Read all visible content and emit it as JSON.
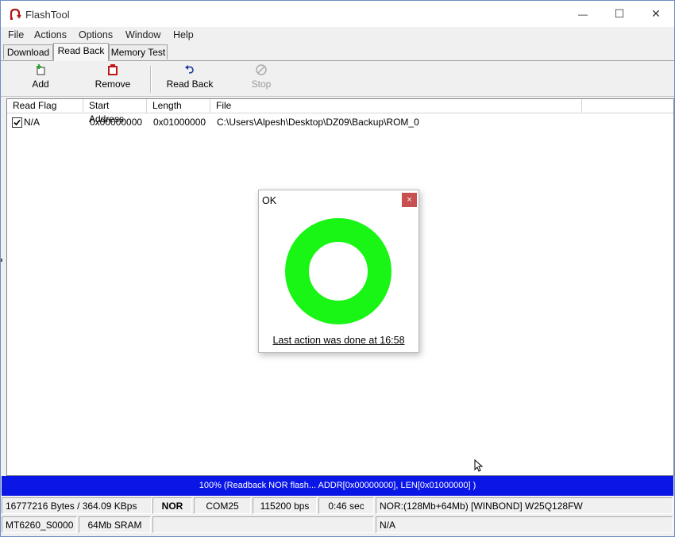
{
  "window": {
    "title": "FlashTool",
    "minimize_symbol": "—",
    "maximize_symbol": "☐",
    "close_symbol": "✕"
  },
  "menu": [
    "File",
    "Actions",
    "Options",
    "Window",
    "Help"
  ],
  "tabs": [
    {
      "label": "Download",
      "active": false
    },
    {
      "label": "Read Back",
      "active": true
    },
    {
      "label": "Memory Test",
      "active": false
    }
  ],
  "toolbar": {
    "add_label": "Add",
    "remove_label": "Remove",
    "readback_label": "Read Back",
    "stop_label": "Stop"
  },
  "list": {
    "columns": [
      "Read Flag",
      "Start Address",
      "Length",
      "File"
    ],
    "rows": [
      {
        "checked": true,
        "read_flag": "N/A",
        "start_address": "0x00000000",
        "length": "0x01000000",
        "file": "C:\\Users\\Alpesh\\Desktop\\DZ09\\Backup\\ROM_0"
      }
    ]
  },
  "dialog": {
    "title": "OK",
    "close_symbol": "×",
    "message": "Last action was done at 16:58",
    "ring_color": "#19f514"
  },
  "progress": {
    "text": "100% (Readback NOR flash... ADDR[0x00000000], LEN[0x01000000]  )",
    "percent": 100,
    "color": "#0a16e6"
  },
  "status": {
    "row1": [
      "16777216 Bytes / 364.09 KBps",
      "NOR",
      "COM25",
      "115200 bps",
      "0:46 sec",
      "NOR:(128Mb+64Mb) [WINBOND] W25Q128FW"
    ],
    "row2": [
      "MT6260_S0000",
      "64Mb SRAM",
      "",
      "N/A"
    ]
  },
  "colors": {
    "add_icon": "#2aa62a",
    "remove_icon": "#c01818",
    "close_button": "#c75050",
    "app_icon": "#b01818"
  }
}
